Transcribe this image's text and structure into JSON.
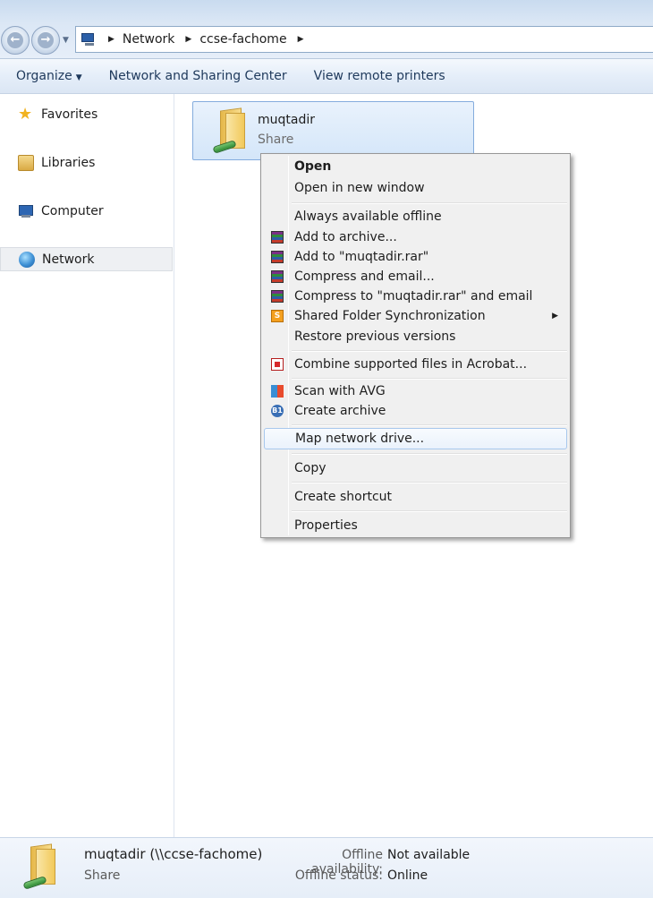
{
  "address": {
    "crumbs": [
      "Network",
      "ccse-fachome"
    ]
  },
  "toolbar": {
    "organize": "Organize",
    "network_sharing": "Network and Sharing Center",
    "remote_printers": "View remote printers"
  },
  "sidebar": {
    "items": [
      {
        "label": "Favorites",
        "icon": "star-icon"
      },
      {
        "label": "Libraries",
        "icon": "libraries-icon"
      },
      {
        "label": "Computer",
        "icon": "computer-icon"
      },
      {
        "label": "Network",
        "icon": "network-icon",
        "selected": true
      }
    ]
  },
  "content": {
    "share_name": "muqtadir",
    "share_type": "Share"
  },
  "context_menu": {
    "items": [
      {
        "label": "Open",
        "bold": true
      },
      {
        "label": "Open in new window"
      },
      {
        "label": "Always available offline"
      },
      {
        "label": "Add to archive...",
        "icon": "winrar-icon"
      },
      {
        "label": "Add to \"muqtadir.rar\"",
        "icon": "winrar-icon"
      },
      {
        "label": "Compress and email...",
        "icon": "winrar-icon"
      },
      {
        "label": "Compress to \"muqtadir.rar\" and email",
        "icon": "winrar-icon"
      },
      {
        "label": "Shared Folder Synchronization",
        "icon": "sync-icon",
        "submenu": true
      },
      {
        "label": "Restore previous versions"
      },
      {
        "label": "Combine supported files in Acrobat...",
        "icon": "acrobat-icon"
      },
      {
        "label": "Scan with AVG",
        "icon": "avg-icon"
      },
      {
        "label": "Create archive",
        "icon": "b1-icon"
      },
      {
        "label": "Map network drive...",
        "highlighted": true
      },
      {
        "label": "Copy"
      },
      {
        "label": "Create shortcut"
      },
      {
        "label": "Properties"
      }
    ]
  },
  "details": {
    "name": "muqtadir (\\\\ccse-fachome)",
    "type": "Share",
    "offline_availability_label": "Offline availability:",
    "offline_availability_value": "Not available",
    "offline_status_label": "Offline status:",
    "offline_status_value": "Online"
  }
}
